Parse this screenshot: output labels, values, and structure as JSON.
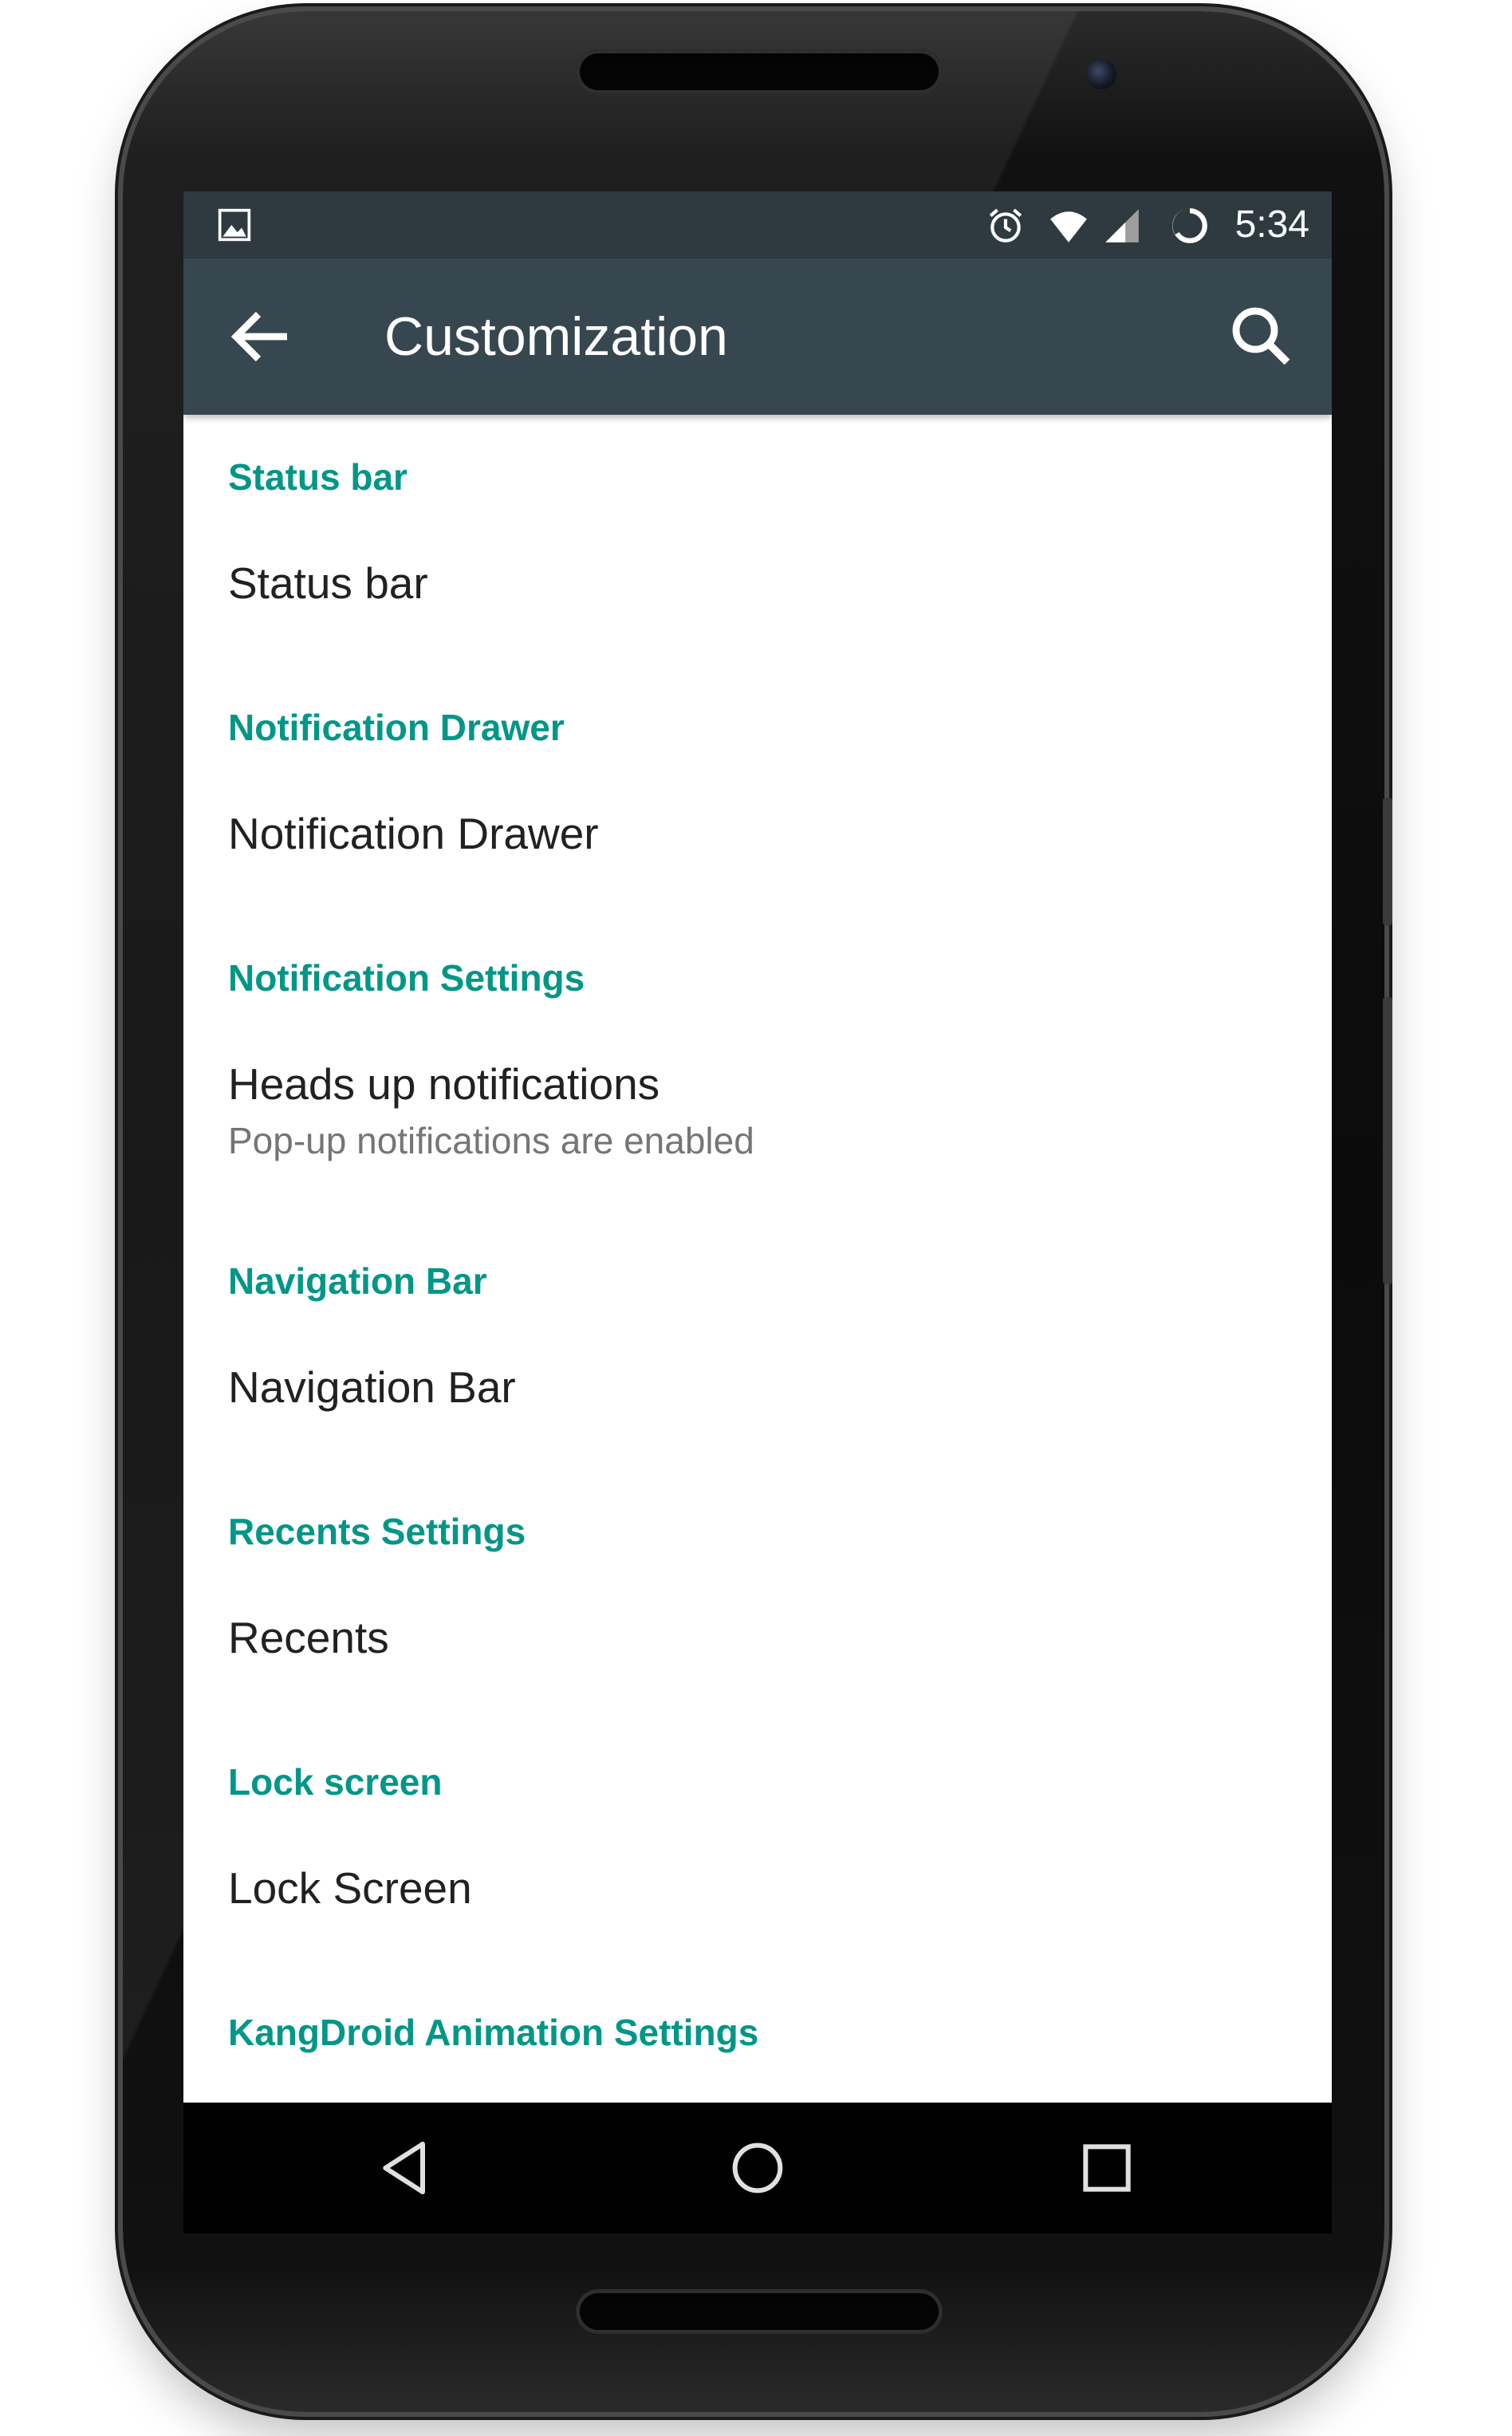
{
  "status_bar": {
    "time": "5:34",
    "icons": [
      "image-notification-icon",
      "alarm-icon",
      "wifi-icon",
      "cell-signal-icon",
      "battery-icon"
    ]
  },
  "app_bar": {
    "title": "Customization",
    "back_icon": "arrow-back-icon",
    "search_icon": "search-icon",
    "color": "#37474f"
  },
  "colors": {
    "accent": "#009688",
    "primary_text": "#212121",
    "secondary_text": "#757575"
  },
  "sections": [
    {
      "header": "Status bar",
      "items": [
        {
          "title": "Status bar",
          "summary": ""
        }
      ]
    },
    {
      "header": "Notification Drawer",
      "items": [
        {
          "title": "Notification Drawer",
          "summary": ""
        }
      ]
    },
    {
      "header": "Notification Settings",
      "items": [
        {
          "title": "Heads up notifications",
          "summary": "Pop-up notifications are enabled"
        }
      ]
    },
    {
      "header": "Navigation Bar",
      "items": [
        {
          "title": "Navigation Bar",
          "summary": ""
        }
      ]
    },
    {
      "header": "Recents Settings",
      "items": [
        {
          "title": "Recents",
          "summary": ""
        }
      ]
    },
    {
      "header": "Lock screen",
      "items": [
        {
          "title": "Lock Screen",
          "summary": ""
        }
      ]
    },
    {
      "header": "KangDroid Animation Settings",
      "items": []
    }
  ],
  "nav_bar": {
    "buttons": [
      "back-triangle-icon",
      "home-circle-icon",
      "recents-square-icon"
    ]
  }
}
